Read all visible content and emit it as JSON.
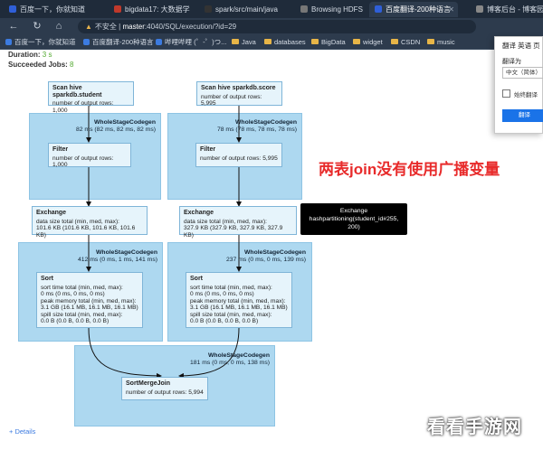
{
  "tabs": [
    {
      "label": "百度一下，你就知道",
      "color": "#2f5fd8"
    },
    {
      "label": "bigdata17: 大数据学",
      "color": "#c0392b"
    },
    {
      "label": "spark/src/main/java",
      "color": "#333333"
    },
    {
      "label": "Browsing HDFS",
      "color": "#777777"
    },
    {
      "label": "百度翻译-200种语言",
      "color": "#2f5fd8"
    },
    {
      "label": "博客后台 - 博客园",
      "color": "#888888"
    }
  ],
  "url": {
    "warning": "不安全",
    "host": "master",
    "path": ":4040/SQL/execution/?id=29"
  },
  "bookmarks": [
    {
      "label": "百度一下，你就知道",
      "kind": "dot"
    },
    {
      "label": "百度翻译-200种语言",
      "kind": "dot"
    },
    {
      "label": "哔哩哔哩 (゜-゜)つ...",
      "kind": "dot"
    },
    {
      "label": "Java",
      "kind": "folder"
    },
    {
      "label": "databases",
      "kind": "folder"
    },
    {
      "label": "BigData",
      "kind": "folder"
    },
    {
      "label": "widget",
      "kind": "folder"
    },
    {
      "label": "CSDN",
      "kind": "folder"
    },
    {
      "label": "music",
      "kind": "folder"
    }
  ],
  "meta": {
    "duration_label": "Duration:",
    "duration_value": "3 s",
    "jobs_label": "Succeeded Jobs:",
    "jobs_value": "8"
  },
  "plan": {
    "scan_student": {
      "title": "Scan hive sparkdb.student",
      "rows": "number of output rows: 1,000"
    },
    "scan_score": {
      "title": "Scan hive sparkdb.score",
      "rows": "number of output rows: 5,995"
    },
    "wsc_left": {
      "title": "WholeStageCodegen",
      "time": "82 ms (82 ms, 82 ms, 82 ms)"
    },
    "wsc_right": {
      "title": "WholeStageCodegen",
      "time": "78 ms (78 ms, 78 ms, 78 ms)"
    },
    "filter_left": {
      "title": "Filter",
      "rows": "number of output rows: 1,000"
    },
    "filter_right": {
      "title": "Filter",
      "rows": "number of output rows: 5,995"
    },
    "exchange_left": {
      "title": "Exchange",
      "l1": "data size total (min, med, max):",
      "l2": "101.6 KB (101.6 KB, 101.6 KB, 101.6 KB)"
    },
    "exchange_right": {
      "title": "Exchange",
      "l1": "data size total (min, med, max):",
      "l2": "327.9 KB (327.9 KB, 327.9 KB, 327.9 KB)"
    },
    "tooltip": {
      "l1": "Exchange",
      "l2": "hashpartitioning(student_id#255,",
      "l3": "200)"
    },
    "wsc2_left": {
      "title": "WholeStageCodegen",
      "time": "412 ms (0 ms, 1 ms, 141 ms)"
    },
    "wsc2_right": {
      "title": "WholeStageCodegen",
      "time": "237 ms (0 ms, 0 ms, 139 ms)"
    },
    "sort_left": {
      "title": "Sort",
      "l1": "sort time total (min, med, max):",
      "l2": "0 ms (0 ms, 0 ms, 0 ms)",
      "l3": "peak memory total (min, med, max):",
      "l4": "3.1 GB (16.1 MB, 16.1 MB, 16.1 MB)",
      "l5": "spill size total (min, med, max):",
      "l6": "0.0 B (0.0 B, 0.0 B, 0.0 B)"
    },
    "sort_right": {
      "title": "Sort",
      "l1": "sort time total (min, med, max):",
      "l2": "0 ms (0 ms, 0 ms, 0 ms)",
      "l3": "peak memory total (min, med, max):",
      "l4": "3.1 GB (16.1 MB, 16.1 MB, 16.1 MB)",
      "l5": "spill size total (min, med, max):",
      "l6": "0.0 B (0.0 B, 0.0 B, 0.0 B)"
    },
    "wsc3": {
      "title": "WholeStageCodegen",
      "time": "181 ms (0 ms, 0 ms, 138 ms)"
    },
    "smj": {
      "title": "SortMergeJoin",
      "rows": "number of output rows: 5,994"
    }
  },
  "annotation": "两表join没有使用广播变量",
  "details_link": "Details",
  "translate_popup": {
    "title": "翻译 英语 页",
    "label": "翻译为",
    "select": "中文（简体）",
    "checkbox": "始终翻译",
    "button": "翻译"
  },
  "watermark": "看看手游网"
}
